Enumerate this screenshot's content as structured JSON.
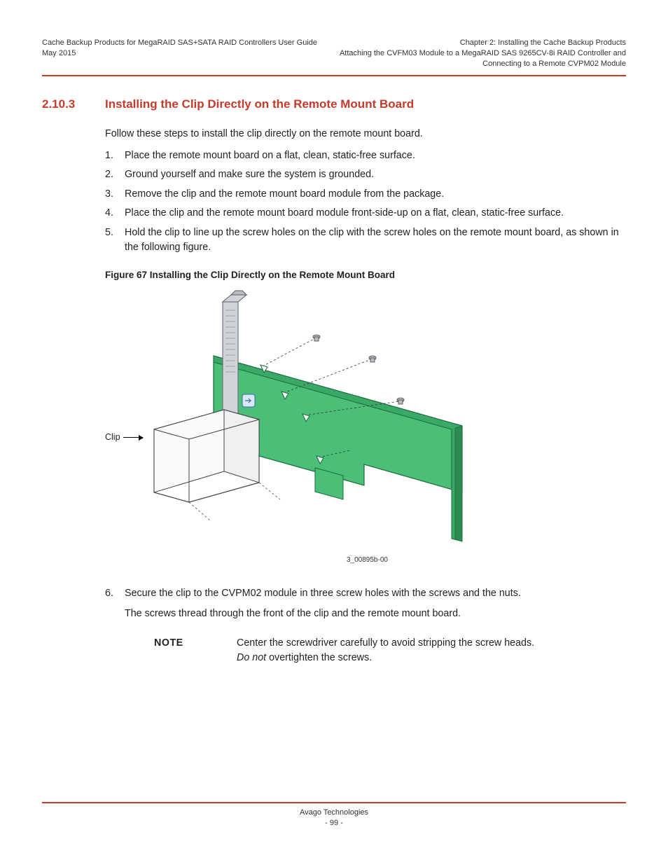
{
  "header": {
    "left_line1": "Cache Backup Products for MegaRAID SAS+SATA RAID Controllers User Guide",
    "left_line2": "May 2015",
    "right_line1": "Chapter 2: Installing the Cache Backup Products",
    "right_line2": "Attaching the CVFM03 Module to a MegaRAID SAS 9265CV-8i RAID Controller and",
    "right_line3": "Connecting to a Remote CVPM02 Module"
  },
  "section": {
    "number": "2.10.3",
    "title": "Installing the Clip Directly on the Remote Mount Board"
  },
  "intro": "Follow these steps to install the clip directly on the remote mount board.",
  "steps_first": [
    "Place the remote mount board on a flat, clean, static-free surface.",
    "Ground yourself and make sure the system is grounded.",
    "Remove the clip and the remote mount board module from the package.",
    "Place the clip and the remote mount board module front-side-up on a flat, clean, static-free surface.",
    "Hold the clip to line up the screw holes on the clip with the screw holes on the remote mount board, as shown in the following figure."
  ],
  "figure": {
    "caption": "Figure 67  Installing the Clip Directly on the Remote Mount Board",
    "clip_label": "Clip",
    "ref": "3_00895b-00"
  },
  "step6_num": "6.",
  "step6_text": "Secure the clip to the CVPM02 module in three screw holes with the screws and the nuts.",
  "step6_sub": "The screws thread through the front of the clip and the remote mount board.",
  "note": {
    "label": "NOTE",
    "line1": "Center the screwdriver carefully to avoid stripping the screw heads.",
    "line2_prefix": "Do not",
    "line2_rest": " overtighten the screws."
  },
  "footer": {
    "company": "Avago Technologies",
    "page": "- 99 -"
  }
}
